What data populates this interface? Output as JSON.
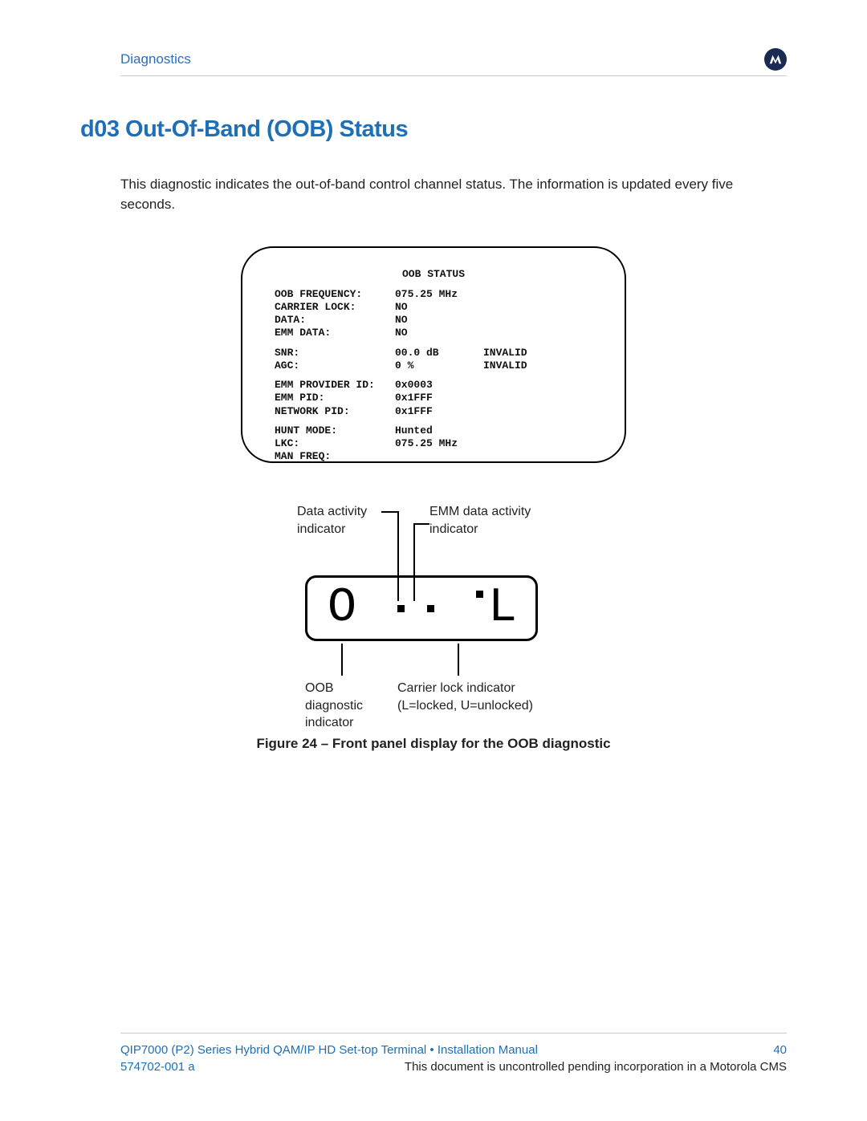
{
  "header": {
    "section": "Diagnostics",
    "logo_name": "motorola-logo-icon"
  },
  "title": "d03 Out-Of-Band (OOB) Status",
  "intro": "This diagnostic indicates the out-of-band control channel status. The information is updated every five seconds.",
  "screen": {
    "title": "OOB STATUS",
    "block1": [
      {
        "label": "OOB FREQUENCY:",
        "value": "075.25 MHz",
        "extra": ""
      },
      {
        "label": "CARRIER LOCK:",
        "value": "NO",
        "extra": ""
      },
      {
        "label": "DATA:",
        "value": "NO",
        "extra": ""
      },
      {
        "label": "EMM DATA:",
        "value": "NO",
        "extra": ""
      }
    ],
    "block2": [
      {
        "label": "SNR:",
        "value": "00.0 dB",
        "extra": "INVALID"
      },
      {
        "label": "AGC:",
        "value": "0 %",
        "extra": "INVALID"
      }
    ],
    "block3": [
      {
        "label": "EMM PROVIDER ID:",
        "value": "0x0003",
        "extra": ""
      },
      {
        "label": "EMM PID:",
        "value": "0x1FFF",
        "extra": ""
      },
      {
        "label": "NETWORK PID:",
        "value": "0x1FFF",
        "extra": ""
      }
    ],
    "block4": [
      {
        "label": "HUNT MODE:",
        "value": "Hunted",
        "extra": ""
      },
      {
        "label": "LKC:",
        "value": "075.25 MHz",
        "extra": ""
      },
      {
        "label": "MAN FREQ:",
        "value": "",
        "extra": ""
      }
    ]
  },
  "diagram": {
    "top_left_label": "Data activity\nindicator",
    "top_right_label": "EMM data activity\nindicator",
    "bottom_left_label": "OOB\ndiagnostic\nindicator",
    "bottom_right_label": "Carrier lock indicator\n(L=locked, U=unlocked)",
    "panel_left_char": "O",
    "panel_right_char": "L"
  },
  "figure_caption": "Figure 24 – Front panel display for the OOB diagnostic",
  "footer": {
    "line1_left": "QIP7000 (P2) Series Hybrid QAM/IP HD Set-top Terminal • Installation Manual",
    "page_number": "40",
    "doc_number": "574702-001 a",
    "line2_right": "This document is uncontrolled pending incorporation in a Motorola CMS"
  }
}
